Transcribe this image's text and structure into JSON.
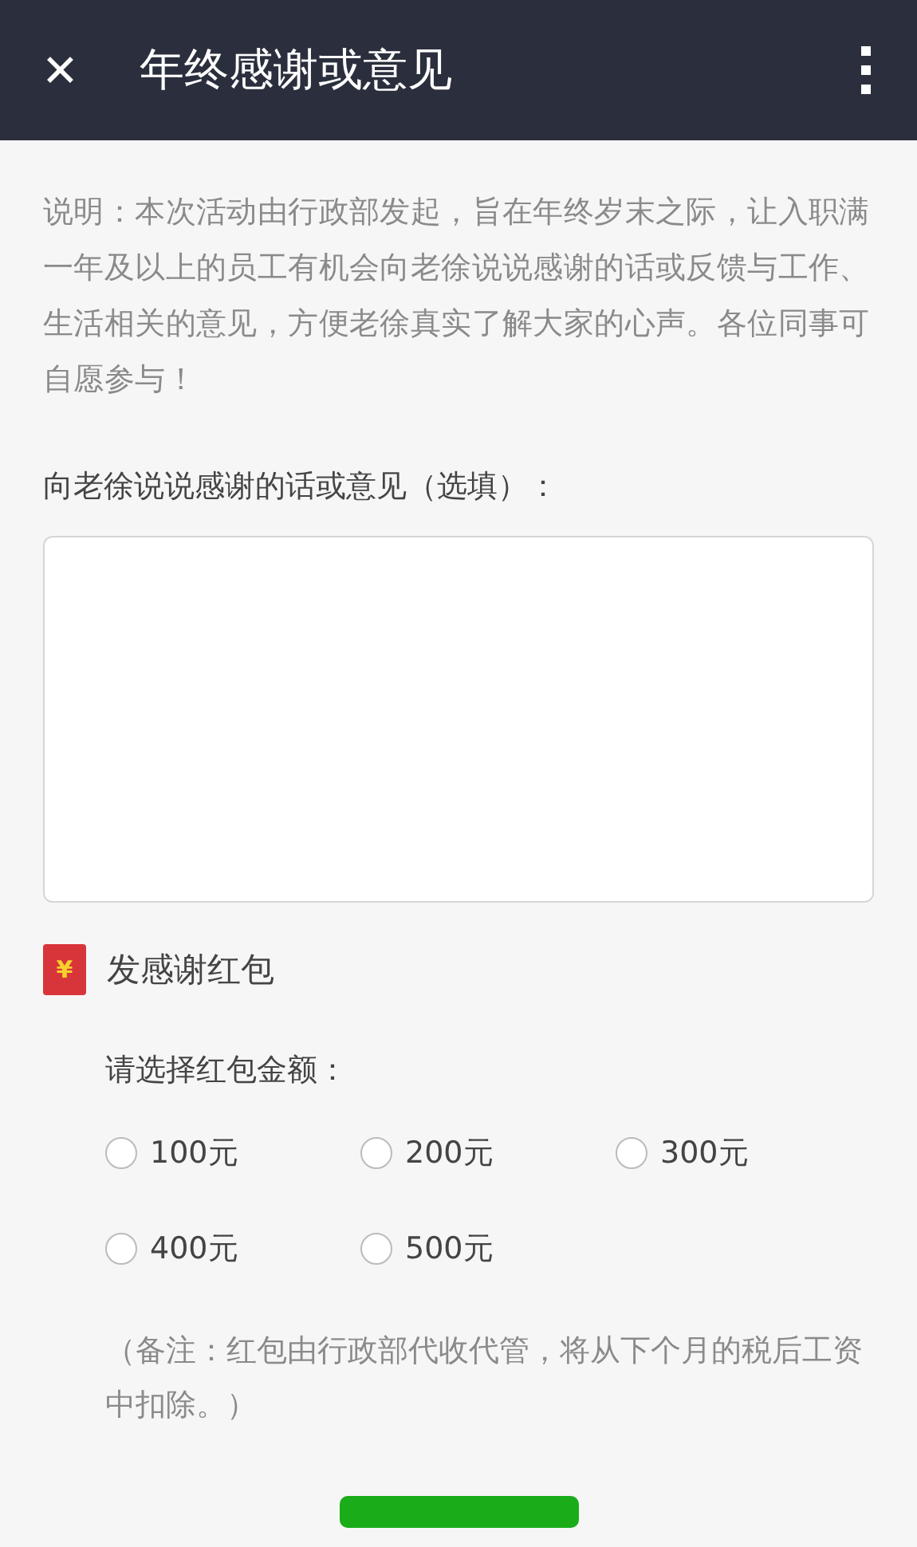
{
  "header": {
    "close": "✕",
    "title": "年终感谢或意见"
  },
  "intro": "说明：本次活动由行政部发起，旨在年终岁末之际，让入职满一年及以上的员工有机会向老徐说说感谢的话或反馈与工作、生活相关的意见，方便老徐真实了解大家的心声。各位同事可自愿参与！",
  "message": {
    "label": "向老徐说说感谢的话或意见（选填）："
  },
  "red_packet": {
    "icon": "¥",
    "label": "发感谢红包",
    "prompt": "请选择红包金额：",
    "amounts": [
      {
        "label": "100元",
        "selected": false
      },
      {
        "label": "200元",
        "selected": false
      },
      {
        "label": "300元",
        "selected": false
      },
      {
        "label": "400元",
        "selected": false
      },
      {
        "label": "500元",
        "selected": false
      }
    ],
    "note": "（备注：红包由行政部代收代管，将从下个月的税后工资中扣除。）"
  }
}
